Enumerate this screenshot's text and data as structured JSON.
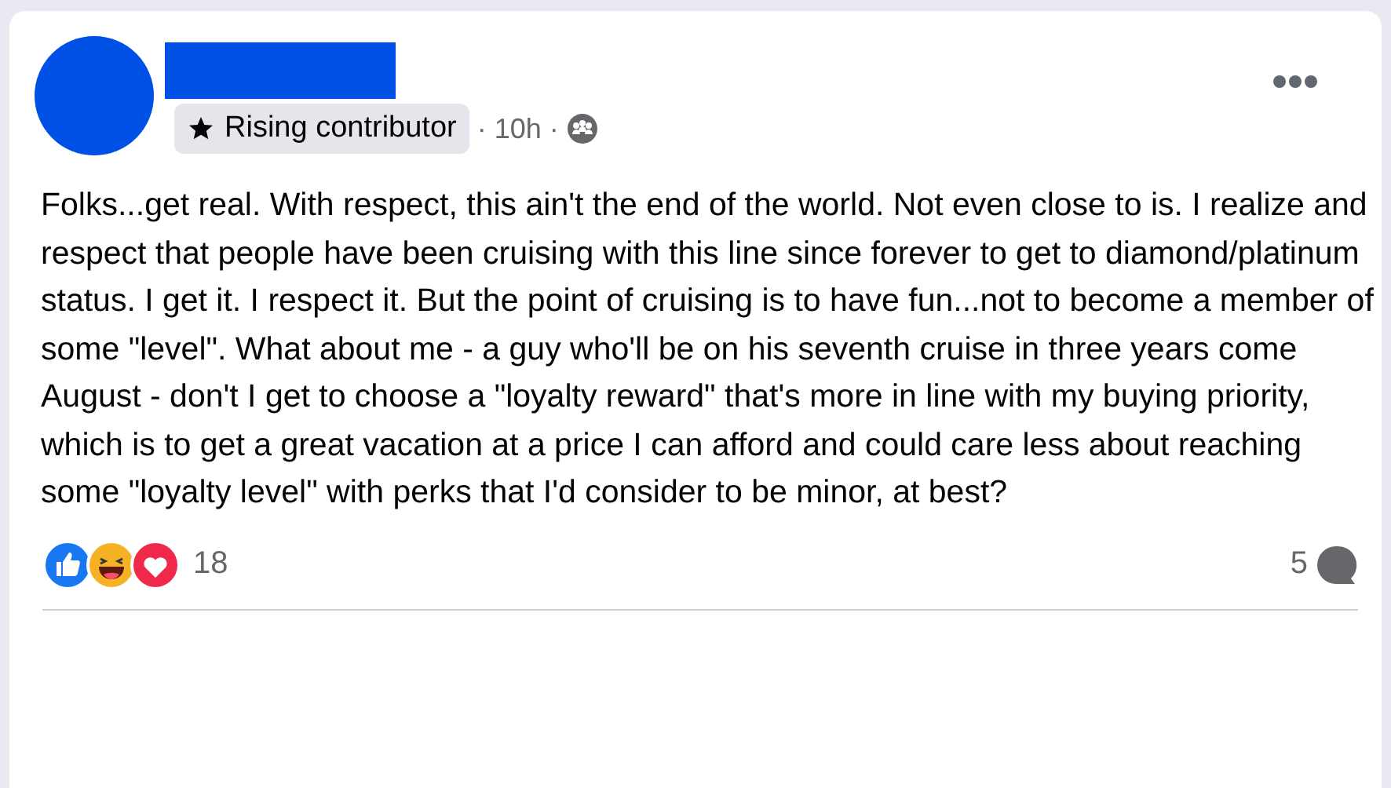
{
  "post": {
    "badge": "Rising contributor",
    "separator_1": "·",
    "time": "10h",
    "separator_2": "·",
    "body": "Folks...get real. With respect, this ain't the end of the world. Not even close to is. I realize and respect that people have been cruising with this line since forever to get to diamond/platinum status. I get it. I respect it. But the point of cruising is to have fun...not to become a member of some \"level\". What about me - a guy who'll be on his seventh cruise in three years come August - don't I get to choose a \"loyalty reward\" that's more in line with my buying priority, which is to get a great vacation at a price I can afford and could care less about reaching some \"loyalty level\" with perks that I'd consider to be minor, at best?",
    "reactions_count": "18",
    "comments_count": "5"
  }
}
